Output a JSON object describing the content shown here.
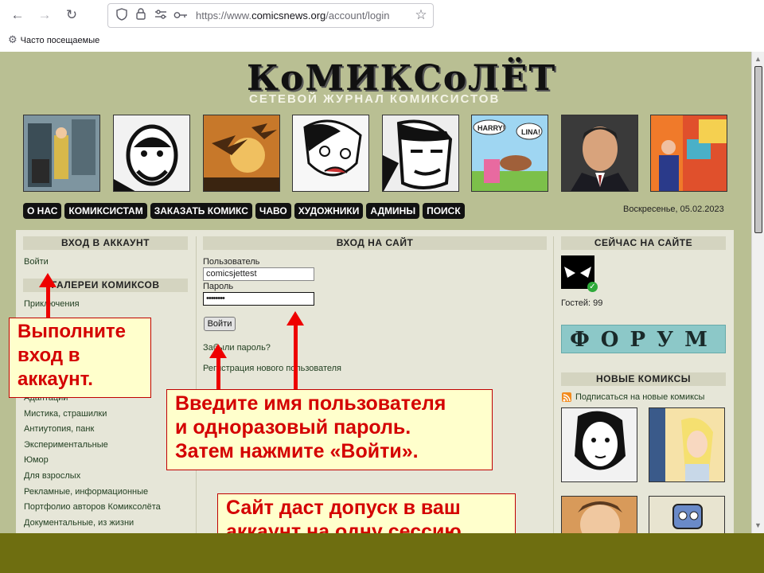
{
  "browser": {
    "url_prefix": "https://www.",
    "url_host": "comicsnews.org",
    "url_path": "/account/login",
    "bookmarks_label": "Часто посещаемые"
  },
  "site": {
    "logo": "КоМИКСоЛЁТ",
    "tagline": "СЕТЕВОЙ ЖУРНАЛ КОМИКСИСТОВ",
    "menu": [
      "О НАС",
      "КОМИКСИСТАМ",
      "ЗАКАЗАТЬ КОМИКС",
      "ЧАВО",
      "ХУДОЖНИКИ",
      "АДМИНЫ",
      "ПОИСК"
    ],
    "date": "Воскресенье, 05.02.2023",
    "thumb_texts": [
      "HARRY!",
      "LINA!"
    ]
  },
  "left": {
    "login_head": "ВХОД В АККАУНТ",
    "login_link": "Войти",
    "galleries_head": "ГАЛЕРЕИ КОМИКСОВ",
    "galleries": [
      "Приключения",
      "Адаптации",
      "Мистика, страшилки",
      "Антиутопия, панк",
      "Экспериментальные",
      "Юмор",
      "Для взрослых",
      "Рекламные, информационные",
      "Портфолио авторов Комиксолёта",
      "Документальные, из жизни"
    ]
  },
  "center": {
    "head": "ВХОД НА САЙТ",
    "user_label": "Пользователь",
    "user_value": "comicsjettest",
    "pass_label": "Пароль",
    "pass_value": "••••••••",
    "submit": "Войти",
    "forgot": "Забыли пароль?",
    "register": "Регистрация нового пользователя"
  },
  "right": {
    "online_head": "СЕЙЧАС НА САЙТЕ",
    "guests": "Гостей: 99",
    "forum": "ФОРУМ",
    "new_head": "НОВЫЕ КОМИКСЫ",
    "subscribe": "Подписаться на новые комиксы"
  },
  "annotations": {
    "callout1": [
      "Выполните",
      "вход в",
      "аккаунт."
    ],
    "callout2": [
      "Введите имя пользователя",
      "и одноразовый пароль.",
      "Затем нажмите «Войти»."
    ],
    "callout3": [
      "Сайт даст допуск в ваш",
      "аккаунт на одну сессию."
    ]
  },
  "colors": {
    "page_bg": "#b9bf93",
    "content_bg": "#e6e6d8",
    "frame": "#6e6e10",
    "callout_text": "#d40000",
    "callout_bg": "#ffffcc",
    "arrow": "#ee0000"
  }
}
